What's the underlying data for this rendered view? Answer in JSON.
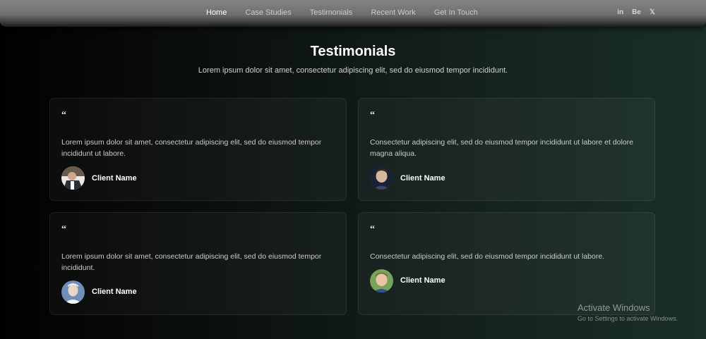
{
  "nav": {
    "links": [
      "Home",
      "Case Studies",
      "Testimonials",
      "Recent Work",
      "Get In Touch"
    ],
    "active": "Home",
    "social": [
      {
        "icon": "linkedin-icon",
        "glyph": "in"
      },
      {
        "icon": "behance-icon",
        "glyph": "Be"
      },
      {
        "icon": "x-twitter-icon",
        "glyph": "𝕏"
      }
    ]
  },
  "section": {
    "title": "Testimonials",
    "subtitle": "Lorem ipsum dolor sit amet, consectetur adipiscing elit, sed do eiusmod tempor incididunt."
  },
  "testimonials": [
    {
      "quote_mark": "“",
      "text": "Lorem ipsum dolor sit amet, consectetur adipiscing elit, sed do eiusmod tempor incididunt ut labore.",
      "name": "Client Name",
      "avatar": "client-avatar-1"
    },
    {
      "quote_mark": "“",
      "text": "Consectetur adipiscing elit, sed do eiusmod tempor incididunt ut labore et dolore magna aliqua.",
      "name": "Client Name",
      "avatar": "client-avatar-2"
    },
    {
      "quote_mark": "“",
      "text": "Lorem ipsum dolor sit amet, consectetur adipiscing elit, sed do eiusmod tempor incididunt.",
      "name": "Client Name",
      "avatar": "client-avatar-3"
    },
    {
      "quote_mark": "“",
      "text": "Consectetur adipiscing elit, sed do eiusmod tempor incididunt ut labore.",
      "name": "Client Name",
      "avatar": "client-avatar-4"
    }
  ],
  "watermark": {
    "title": "Activate Windows",
    "subtitle": "Go to Settings to activate Windows."
  }
}
